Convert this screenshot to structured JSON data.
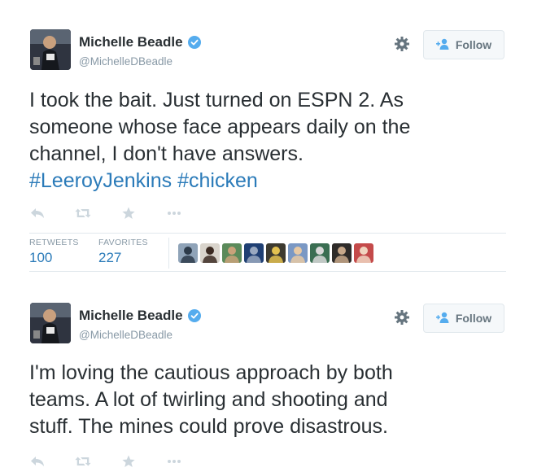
{
  "tweets": [
    {
      "name": "Michelle Beadle",
      "handle": "@MichelleDBeadle",
      "follow_label": "Follow",
      "text_lines": [
        "I took the bait. Just turned on ESPN 2.  As",
        "someone whose face appears daily on the",
        "channel, I don't have answers."
      ],
      "hashtags": [
        "#LeeroyJenkins",
        "#chicken"
      ],
      "stats": {
        "retweets_label": "RETWEETS",
        "retweets_count": "100",
        "favorites_label": "FAVORITES",
        "favorites_count": "227"
      },
      "favoriter_avatars": [
        {
          "name": "favoriter-avatar-1",
          "bg": "#8fa3b8",
          "fg": "#2d3b4a"
        },
        {
          "name": "favoriter-avatar-2",
          "bg": "#d9d4cc",
          "fg": "#3b2a22"
        },
        {
          "name": "favoriter-avatar-3",
          "bg": "#5b8a5a",
          "fg": "#c9a27a"
        },
        {
          "name": "favoriter-avatar-4",
          "bg": "#1f3f73",
          "fg": "#9aa9c0"
        },
        {
          "name": "favoriter-avatar-5",
          "bg": "#3d3a30",
          "fg": "#e3c150"
        },
        {
          "name": "favoriter-avatar-6",
          "bg": "#7a98c4",
          "fg": "#e7c9a4"
        },
        {
          "name": "favoriter-avatar-7",
          "bg": "#3a6e52",
          "fg": "#d9d9d9"
        },
        {
          "name": "favoriter-avatar-8",
          "bg": "#2e2b29",
          "fg": "#c7a88a"
        },
        {
          "name": "favoriter-avatar-9",
          "bg": "#c44a4a",
          "fg": "#f0d4bf"
        }
      ]
    },
    {
      "name": "Michelle Beadle",
      "handle": "@MichelleDBeadle",
      "follow_label": "Follow",
      "text_lines": [
        "I'm loving the cautious approach by both",
        "teams. A lot of twirling and shooting and",
        "stuff. The mines could prove disastrous."
      ]
    }
  ],
  "icons": {
    "verified": "verified-badge-icon",
    "gear": "gear-icon",
    "follow": "add-user-icon",
    "reply": "reply-icon",
    "retweet": "retweet-icon",
    "favorite": "star-icon",
    "more": "more-icon"
  },
  "colors": {
    "link": "#2b7bb9",
    "verified": "#55acee",
    "muted": "#8899a6",
    "icon": "#ccd6dd",
    "button_bg": "#f5f8fa"
  }
}
